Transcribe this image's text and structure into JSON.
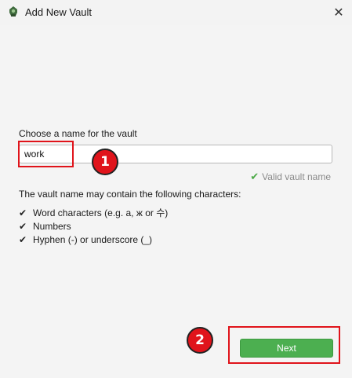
{
  "window": {
    "title": "Add New Vault",
    "icon": "vault-app-icon",
    "close_glyph": "✕"
  },
  "form": {
    "name_label": "Choose a name for the vault",
    "name_value": "work",
    "validation_text": "Valid vault name",
    "validation_color": "#4aa945",
    "info_text": "The vault name may contain the following characters:",
    "allowed_characters": [
      "Word characters (e.g. a, ж or 수)",
      "Numbers",
      "Hyphen (-) or underscore (_)"
    ],
    "check_glyph": "✔"
  },
  "buttons": {
    "next_label": "Next",
    "next_color": "#4caf50"
  },
  "annotations": {
    "badge_1": "1",
    "badge_2": "2",
    "color": "#e0141b"
  }
}
